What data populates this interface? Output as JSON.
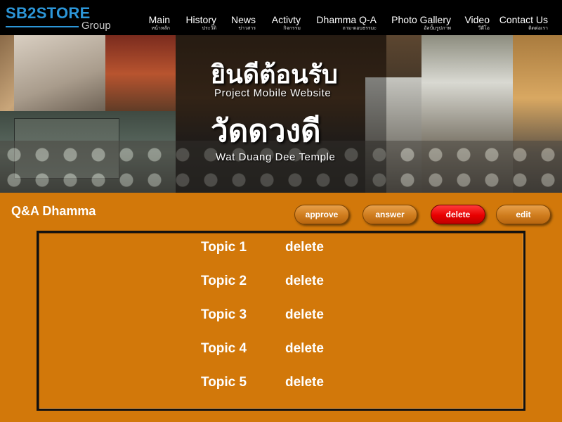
{
  "brand": {
    "name": "SB2STORE",
    "sub": "Group"
  },
  "nav": [
    {
      "label": "Main",
      "sub": "หน้าหลัก"
    },
    {
      "label": "History",
      "sub": "ประวัติ"
    },
    {
      "label": "News",
      "sub": "ข่าวสาร"
    },
    {
      "label": "Activty",
      "sub": "กิจกรรม"
    },
    {
      "label": "Dhamma Q-A",
      "sub": "ถาม-ตอบธรรมะ"
    },
    {
      "label": "Photo Gallery",
      "sub": "อัลบั้มรูปภาพ"
    },
    {
      "label": "Video",
      "sub": "วีดีโอ"
    },
    {
      "label": "Contact Us",
      "sub": "ติดต่อเรา"
    }
  ],
  "banner": {
    "welcome_th": "ยินดีต้อนรับ",
    "line1": "Project Mobile Website",
    "temple_th": "วัดดวงดี",
    "line2": "Wat Duang Dee Temple"
  },
  "page": {
    "title": "Q&A Dhamma"
  },
  "actions": {
    "approve": "approve",
    "answer": "answer",
    "delete": "delete",
    "edit": "edit"
  },
  "topics": [
    {
      "title": "Topic 1",
      "action": "delete"
    },
    {
      "title": "Topic 2",
      "action": "delete"
    },
    {
      "title": "Topic 3",
      "action": "delete"
    },
    {
      "title": "Topic 4",
      "action": "delete"
    },
    {
      "title": "Topic 5",
      "action": "delete"
    }
  ],
  "colors": {
    "background": "#d2780a",
    "nav": "#000000",
    "brand": "#2c96d8",
    "delete": "#e80000"
  }
}
